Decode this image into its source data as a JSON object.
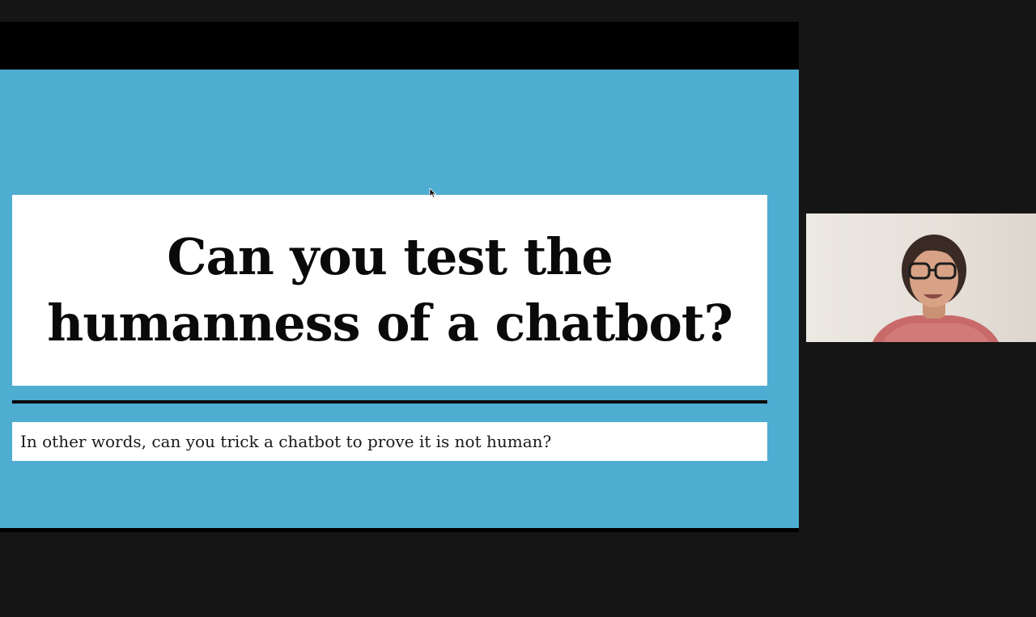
{
  "presentation": {
    "title": "Can you test the humanness of a chatbot?",
    "subtitle": "In other words, can you trick a chatbot to prove it is not human?"
  },
  "colors": {
    "slide_background": "#4eadd1",
    "window_background": "#151515",
    "share_letterbox": "#000000",
    "text": "#0a0a0a"
  },
  "icons": {
    "cursor": "mouse-pointer-icon"
  },
  "video": {
    "participant": "participant-video"
  }
}
